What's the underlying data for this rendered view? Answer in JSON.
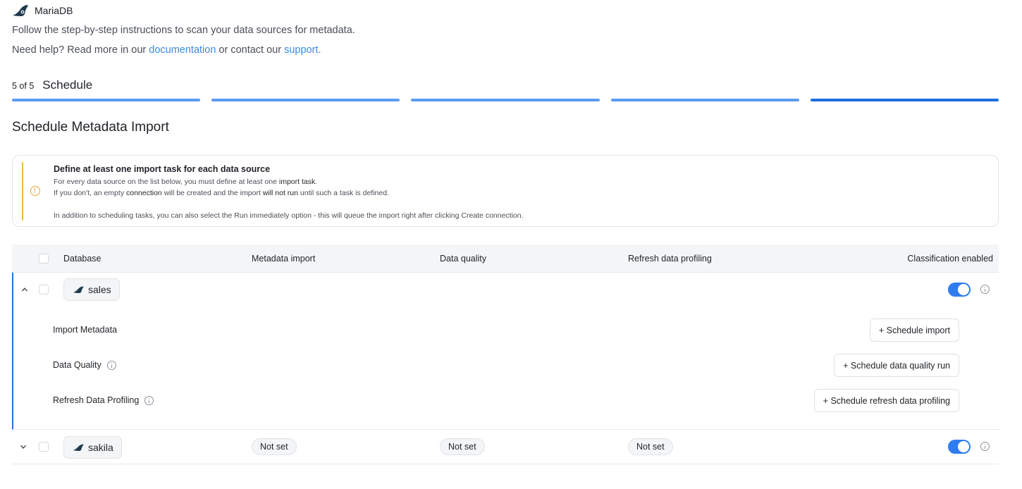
{
  "brand": {
    "name": "MariaDB"
  },
  "intro": "Follow the step-by-step instructions to scan your data sources for metadata.",
  "help": {
    "prefix": "Need help? Read more in our ",
    "doc_link": "documentation",
    "middle": " or contact our ",
    "support_link": "support."
  },
  "step": {
    "count": "5 of 5",
    "title": "Schedule",
    "total": 5,
    "current": 5
  },
  "section_title": "Schedule Metadata Import",
  "notice": {
    "title": "Define at least one import task for each data source",
    "line1_a": "For every data source on the list below, you must define at least one ",
    "line1_b": "import task",
    "line1_c": ".",
    "line2_a": "If you don't, an empty ",
    "line2_b": "connection",
    "line2_c": " will be created and the import ",
    "line2_d": "will not run",
    "line2_e": " until such a task is defined.",
    "line3": "In addition to scheduling tasks, you can also select the Run immediately option - this will queue the import right after clicking Create connection."
  },
  "table": {
    "columns": {
      "database": "Database",
      "metadata_import": "Metadata import",
      "data_quality": "Data quality",
      "refresh_profiling": "Refresh data profiling",
      "classification": "Classification enabled"
    },
    "rows": [
      {
        "name": "sales",
        "expanded": true,
        "classification_enabled": true,
        "tasks": {
          "import_metadata": {
            "label": "Import Metadata",
            "button": "+ Schedule import"
          },
          "data_quality": {
            "label": "Data Quality",
            "button": "+ Schedule data quality run"
          },
          "refresh_profiling": {
            "label": "Refresh Data Profiling",
            "button": "+ Schedule refresh data profiling"
          }
        }
      },
      {
        "name": "sakila",
        "expanded": false,
        "classification_enabled": true,
        "metadata_import": "Not set",
        "data_quality": "Not set",
        "refresh_profiling": "Not set"
      }
    ]
  },
  "colors": {
    "accent": "#2f7cf0",
    "progress": "#5b9bf0",
    "warning": "#e8b84a",
    "link": "#3b8ae0"
  },
  "icons": {
    "brand": "mariadb-seal-icon",
    "db": "mariadb-seal-icon",
    "notice": "warning-clock-icon",
    "info": "info-icon",
    "expanded": "chevron-up-icon",
    "collapsed": "chevron-down-icon"
  }
}
